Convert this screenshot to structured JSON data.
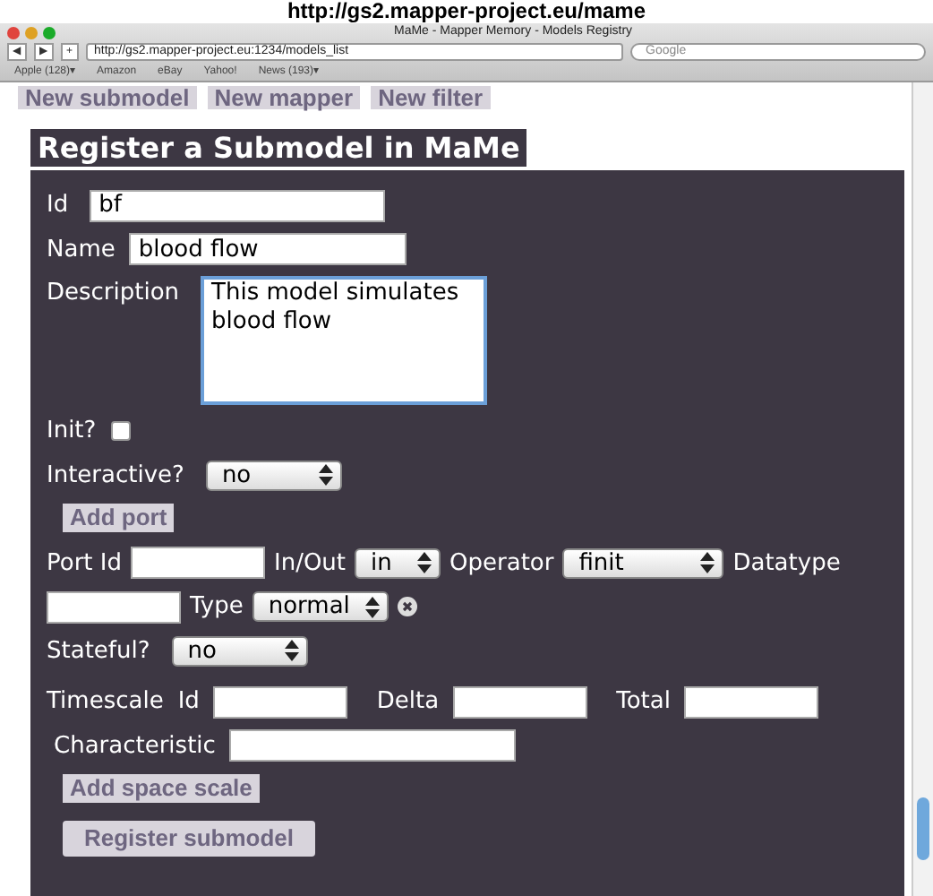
{
  "heading": "http://gs2.mapper-project.eu/mame",
  "window": {
    "title": "MaMe - Mapper Memory - Models Registry"
  },
  "toolbar": {
    "buttons": [
      "◀",
      "▶",
      "+"
    ],
    "address": "http://gs2.mapper-project.eu:1234/models_list",
    "search": {
      "placeholder": "Google"
    }
  },
  "bookmarks": [
    "Apple (128)▾",
    "Amazon",
    "eBay",
    "Yahoo!",
    "News (193)▾"
  ],
  "nav_buttons": [
    "New submodel",
    "New mapper",
    "New filter"
  ],
  "form": {
    "title": "Register a Submodel in MaMe",
    "id": {
      "label": "Id",
      "value": "bf"
    },
    "name": {
      "label": "Name",
      "value": "blood flow"
    },
    "description": {
      "label": "Description",
      "value": "This model simulates blood flow"
    },
    "init": {
      "label": "Init?",
      "checked": false
    },
    "interactive": {
      "label": "Interactive?",
      "value": "no"
    },
    "add_port": "Add port",
    "port": {
      "port_id": "Port Id",
      "in_out": {
        "label": "In/Out",
        "value": "in"
      },
      "operator": {
        "label": "Operator",
        "value": "finit"
      },
      "datatype": "Datatype",
      "type": {
        "label": "Type",
        "value": "normal"
      }
    },
    "stateful": {
      "label": "Stateful?",
      "value": "no"
    },
    "timescale": {
      "label": "Timescale",
      "id": "Id",
      "delta": "Delta",
      "total": "Total",
      "characteristic": "Characteristic"
    },
    "add_space_scale": "Add space scale",
    "submit": "Register submodel"
  }
}
